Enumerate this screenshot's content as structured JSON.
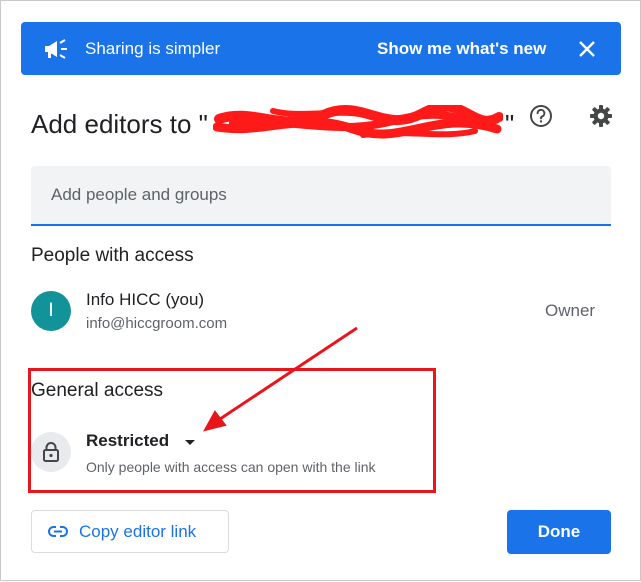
{
  "banner": {
    "icon": "megaphone-icon",
    "message": "Sharing is simpler",
    "action_label": "Show me what's new",
    "close_icon": "close-icon",
    "background_color": "#1a73e8"
  },
  "dialog": {
    "title_prefix": "Add editors to \"",
    "title_suffix": "\"",
    "help_icon": "help-icon",
    "settings_icon": "settings-icon"
  },
  "add_people": {
    "placeholder": "Add people and groups"
  },
  "people_section": {
    "heading": "People with access",
    "people": [
      {
        "avatar_letter": "I",
        "name": "Info HICC (you)",
        "email": "info@hiccgroom.com",
        "role": "Owner",
        "avatar_color": "#12939a"
      }
    ]
  },
  "general_access": {
    "heading": "General access",
    "icon": "lock-icon",
    "level": "Restricted",
    "description": "Only people with access can open with the link"
  },
  "footer": {
    "copy_link_icon": "link-icon",
    "copy_link_label": "Copy editor link",
    "done_label": "Done"
  },
  "annotation": {
    "color": "#e8161b"
  }
}
